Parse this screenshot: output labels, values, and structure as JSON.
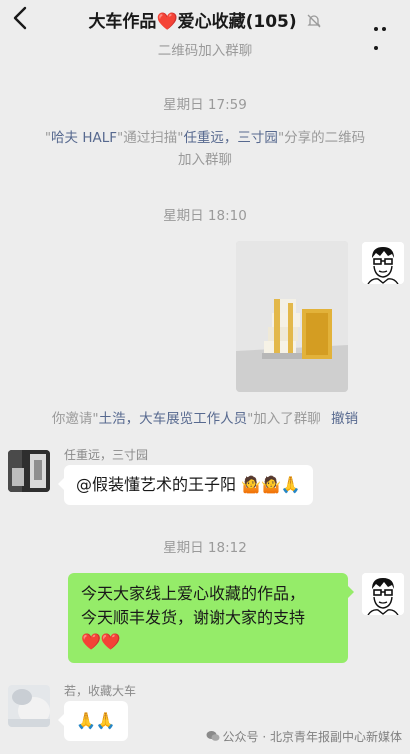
{
  "header": {
    "title_prefix": "大车作品",
    "title_heart": "❤️",
    "title_suffix": "爱心收藏(105)"
  },
  "messages": {
    "sys_qr_top": "二维码加入群聊",
    "time_1": "星期日 17:59",
    "sys_qr_q1": "\"",
    "sys_qr_name1": "哈夫 HALF",
    "sys_qr_mid": "\"通过扫描\"",
    "sys_qr_name2": "任重远，三寸园",
    "sys_qr_tail": "\"分享的二维码",
    "sys_qr_line2": "加入群聊",
    "time_2": "星期日 18:10",
    "invite_prefix": "你邀请\"",
    "invite_names": "土浩，大车展览工作人员",
    "invite_suffix": "\"加入了群聊",
    "invite_revoke": "撤销",
    "msg1_sender": "任重远，三寸园",
    "msg1_text": "@假装懂艺术的王子阳 🤷🤷🙏",
    "time_3": "星期日 18:12",
    "msg2_line1": "今天大家线上爱心收藏的作品，",
    "msg2_line2": "今天顺丰发货，谢谢大家的支持",
    "msg2_line3": "❤️❤️",
    "msg3_sender": "若，收藏大车",
    "msg3_text": "🙏🙏"
  },
  "watermark": {
    "text": "公众号 · 北京青年报副中心新媒体"
  },
  "colors": {
    "background": "#ededed",
    "bubble_self": "#95ec69",
    "bubble_other": "#ffffff",
    "link": "#57698f"
  }
}
